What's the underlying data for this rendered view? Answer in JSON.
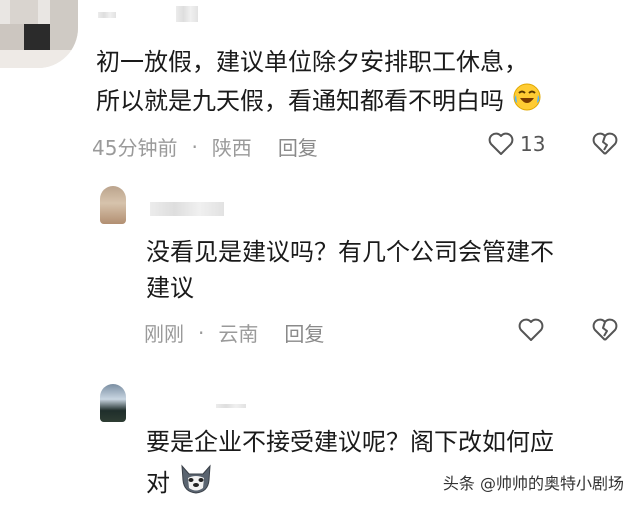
{
  "comment_main": {
    "line1": "初一放假，建议单位除夕安排职工休息，",
    "line2": "所以就是九天假，看通知都看不明白吗",
    "time": "45分钟前",
    "sep": "·",
    "location": "陕西",
    "reply_label": "回复",
    "like_count": "13"
  },
  "reply_1": {
    "line1": "没看见是建议吗？有几个公司会管建不",
    "line2": "建议",
    "time": "刚刚",
    "sep": "·",
    "location": "云南",
    "reply_label": "回复"
  },
  "reply_2": {
    "line1": "要是企业不接受建议呢？阁下改如何应",
    "line2": "对"
  },
  "watermark": {
    "text": "头条 @帅帅的奥特小剧场"
  },
  "icons": {
    "laugh": "laughing-crying-emoji",
    "like": "heart-outline-icon",
    "dislike": "broken-heart-icon",
    "dog": "husky-emoji"
  }
}
